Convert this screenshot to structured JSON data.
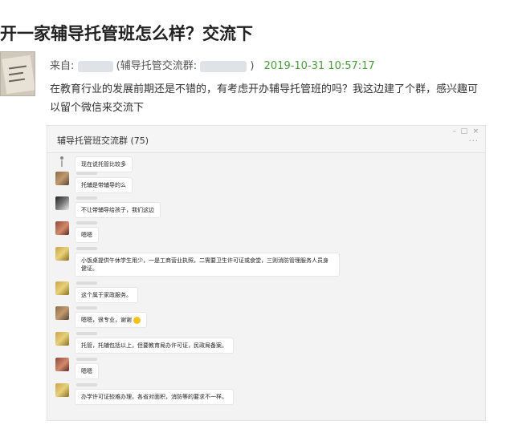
{
  "post": {
    "title": "开一家辅导托管班怎么样？交流下",
    "from_label": "来自:",
    "source_fragment": "(辅导托管交流群:",
    "source_close": ")",
    "date": "2019-10-31 10:57:17",
    "body": "在教育行业的发展前期还是不错的，有考虑开办辅导托管班的吗？我这边建了个群，感兴趣可以留个微信来交流下"
  },
  "chat": {
    "title": "辅导托管班交流群 (75)",
    "controls": [
      "–",
      "□",
      "×"
    ],
    "more": "···",
    "messages": [
      {
        "avatar": "stick-icon",
        "text": "现在说托管比较多"
      },
      {
        "avatar": "av-a",
        "text": "托辅是带辅导的么"
      },
      {
        "avatar": "av-c",
        "text": "不让带辅导给孩子，我们这边"
      },
      {
        "avatar": "av-d",
        "text": "嗯嗯"
      },
      {
        "avatar": "av-b",
        "text": "小饭桌提供午休学生用少，一是工商营业执照，二需要卫生许可证或食堂，三则消防管理服务人员身健证。"
      },
      {
        "avatar": "av-b",
        "text": "这个属于家政服务。"
      },
      {
        "avatar": "av-a",
        "text": "嗯嗯，很专业，谢谢"
      },
      {
        "avatar": "av-b",
        "text": "托管，托辅包括以上，但要教育局办许可证，民政局备案。"
      },
      {
        "avatar": "av-d",
        "text": "嗯嗯"
      },
      {
        "avatar": "av-b",
        "text": "办学许可证较难办理，各省对面积，消防等的要求不一样。"
      }
    ]
  }
}
